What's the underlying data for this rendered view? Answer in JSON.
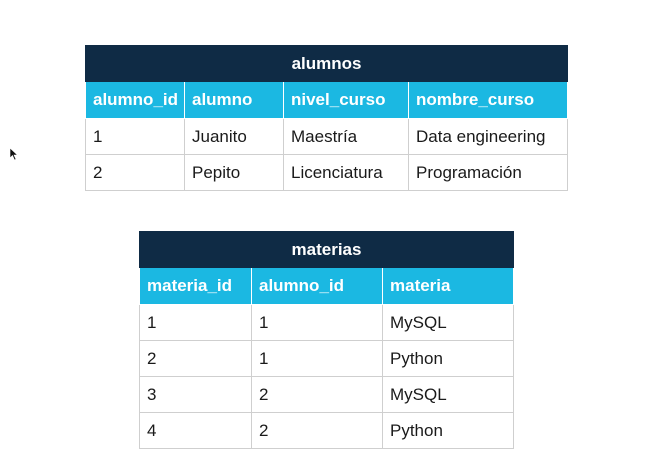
{
  "alumnos": {
    "title": "alumnos",
    "headers": [
      "alumno_id",
      "alumno",
      "nivel_curso",
      "nombre_curso"
    ],
    "rows": [
      [
        "1",
        "Juanito",
        "Maestría",
        "Data engineering"
      ],
      [
        "2",
        "Pepito",
        "Licenciatura",
        "Programación"
      ]
    ]
  },
  "materias": {
    "title": "materias",
    "headers": [
      "materia_id",
      "alumno_id",
      "materia"
    ],
    "rows": [
      [
        "1",
        "1",
        "MySQL"
      ],
      [
        "2",
        "1",
        "Python"
      ],
      [
        "3",
        "2",
        "MySQL"
      ],
      [
        "4",
        "2",
        "Python"
      ]
    ]
  },
  "colors": {
    "title_bg": "#0f2b45",
    "header_bg": "#1bb8e2",
    "border": "#cfcfcf"
  },
  "icons": {
    "cursor": "mouse-pointer-icon"
  }
}
